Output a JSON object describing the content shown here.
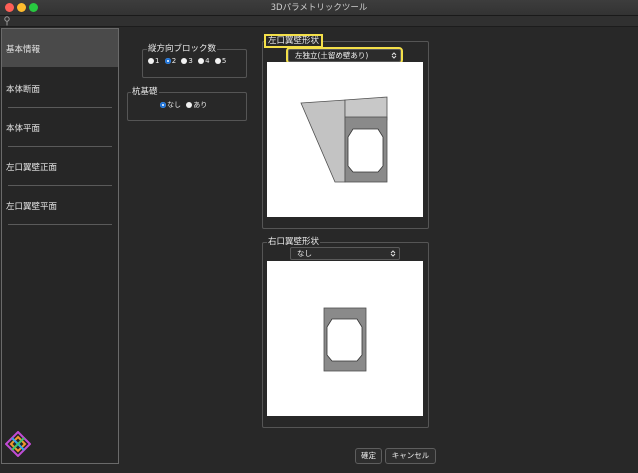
{
  "window": {
    "title": "3Dパラメトリックツール"
  },
  "sidebar": {
    "items": [
      {
        "label": "基本情報",
        "active": true
      },
      {
        "label": "本体断面",
        "active": false
      },
      {
        "label": "本体平面",
        "active": false
      },
      {
        "label": "左口翼壁正面",
        "active": false
      },
      {
        "label": "左口翼壁平面",
        "active": false
      }
    ]
  },
  "blocks": {
    "title": "縦方向ブロック数",
    "options": [
      "1",
      "2",
      "3",
      "4",
      "5"
    ],
    "selected": "2"
  },
  "pile": {
    "title": "杭基礎",
    "options": [
      "なし",
      "あり"
    ],
    "selected": "なし"
  },
  "left_wing": {
    "title": "左口翼壁形状",
    "selected_value": "左独立(土留め壁あり)"
  },
  "right_wing": {
    "title": "右口翼壁形状",
    "selected_value": "なし"
  },
  "buttons": {
    "ok_label": "確定",
    "cancel_label": "キャンセル"
  },
  "colors": {
    "selection": "#1e73d8",
    "highlight": "#f4e04a"
  }
}
